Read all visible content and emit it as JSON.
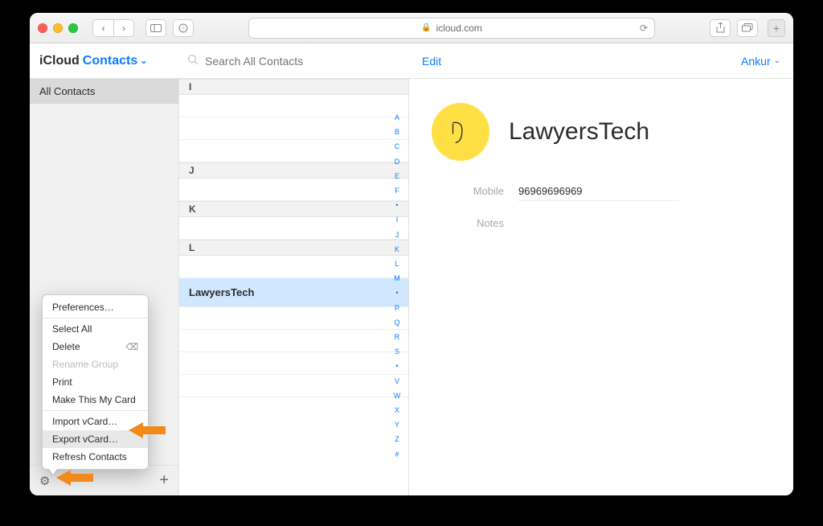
{
  "safari": {
    "url_host": "icloud.com"
  },
  "header": {
    "brand": "iCloud",
    "app": "Contacts",
    "search_placeholder": "Search All Contacts",
    "edit": "Edit",
    "user": "Ankur"
  },
  "sidebar": {
    "all_contacts": "All Contacts"
  },
  "sections": {
    "I": "I",
    "J": "J",
    "K": "K",
    "L": "L"
  },
  "selected_contact_row": "LawyersTech",
  "alpha_index": [
    "A",
    "B",
    "C",
    "D",
    "E",
    "F",
    "•",
    "I",
    "J",
    "K",
    "L",
    "M",
    "•",
    "P",
    "Q",
    "R",
    "S",
    "•",
    "V",
    "W",
    "X",
    "Y",
    "Z",
    "#"
  ],
  "contact": {
    "name": "LawyersTech",
    "mobile_label": "Mobile",
    "mobile_value": "96969696969",
    "notes_label": "Notes"
  },
  "menu": {
    "preferences": "Preferences…",
    "select_all": "Select All",
    "delete": "Delete",
    "rename_group": "Rename Group",
    "print": "Print",
    "make_my_card": "Make This My Card",
    "import_vcard": "Import vCard…",
    "export_vcard": "Export vCard…",
    "refresh": "Refresh Contacts"
  }
}
